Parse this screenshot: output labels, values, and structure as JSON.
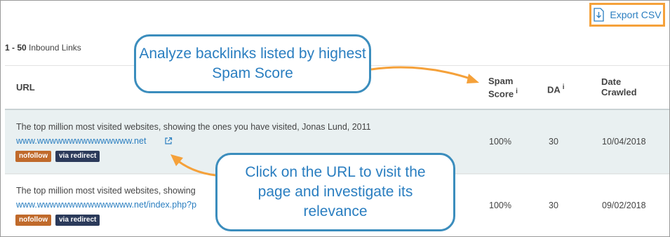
{
  "toolbar": {
    "export_label": "Export CSV"
  },
  "summary": {
    "range": "1 - 50",
    "label": "Inbound Links"
  },
  "table": {
    "headers": {
      "url": "URL",
      "spam_line1": "Spam",
      "spam_line2": "Score",
      "spam_info": "i",
      "da": "DA",
      "da_info": "i",
      "date_line1": "Date",
      "date_line2": "Crawled"
    },
    "rows": [
      {
        "title": "The top million most visited websites, showing the ones you have visited, Jonas Lund, 2011",
        "url": "www.wwwwwwwwwwwwwww.net",
        "badges": [
          "nofollow",
          "via redirect"
        ],
        "spam_score": "100%",
        "da": "30",
        "date": "10/04/2018"
      },
      {
        "title": "The top million most visited websites, showing",
        "url": "www.wwwwwwwwwwwwwww.net/index.php?p",
        "badges": [
          "nofollow",
          "via redirect"
        ],
        "spam_score": "100%",
        "da": "30",
        "date": "09/02/2018"
      }
    ]
  },
  "callouts": {
    "spam": "Analyze backlinks listed by highest Spam Score",
    "url": "Click on the URL to visit the page and investigate its relevance"
  },
  "colors": {
    "accent_orange": "#f5a13a",
    "link_blue": "#2a7ec0",
    "bubble_border": "#3b8dbd",
    "badge_nofollow": "#c06a2b",
    "badge_redirect": "#2b3a5a"
  }
}
